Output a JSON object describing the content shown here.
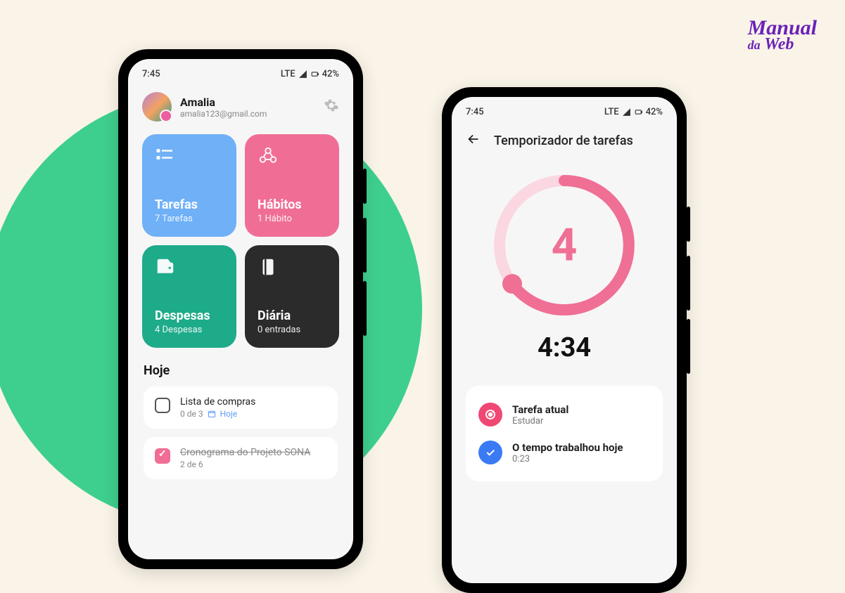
{
  "logo": {
    "line1": "Manual",
    "line2_a": "da",
    "line2_b": "Web"
  },
  "status": {
    "time": "7:45",
    "net": "LTE",
    "battery": "42%"
  },
  "profile": {
    "name": "Amalia",
    "email": "amalia123@gmail.com"
  },
  "cards": {
    "tasks": {
      "title": "Tarefas",
      "sub": "7 Tarefas"
    },
    "habits": {
      "title": "Hábitos",
      "sub": "1 Hábito"
    },
    "expenses": {
      "title": "Despesas",
      "sub": "4 Despesas"
    },
    "diary": {
      "title": "Diária",
      "sub": "0 entradas"
    }
  },
  "today": {
    "heading": "Hoje",
    "items": [
      {
        "title": "Lista de compras",
        "sub": "0 de 3",
        "tag": "Hoje",
        "done": false
      },
      {
        "title": "Cronograma do Projeto SONA",
        "sub": "2 de 6",
        "done": true
      }
    ]
  },
  "timer": {
    "title": "Temporizador de tarefas",
    "cycle_number": "4",
    "elapsed": "4:34",
    "current_label": "Tarefa atual",
    "current_value": "Estudar",
    "worked_label": "O tempo trabalhou hoje",
    "worked_value": "0:23"
  }
}
